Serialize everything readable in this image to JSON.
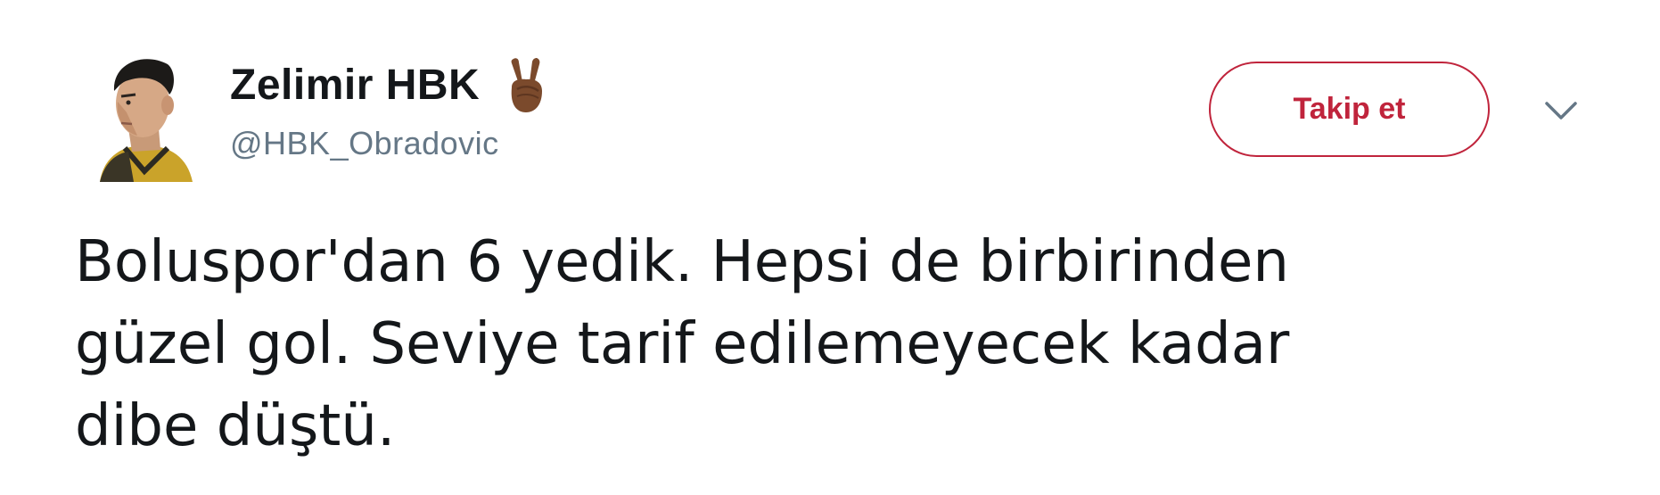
{
  "user": {
    "display_name": "Zelimir HBK",
    "handle": "@HBK_Obradovic",
    "avatar_icon": "profile-photo",
    "badge_icon": "victory-hand-emoji"
  },
  "follow_button": {
    "label": "Takip et",
    "color": "#c0243c"
  },
  "menu": {
    "icon": "chevron-down-icon"
  },
  "tweet": {
    "text": "Boluspor'dan 6 yedik. Hepsi de birbirinden\ngüzel gol. Seviye tarif edilemeyecek kadar\ndibe düştü."
  },
  "colors": {
    "text_primary": "#14171a",
    "text_secondary": "#657786",
    "accent": "#c0243c"
  }
}
